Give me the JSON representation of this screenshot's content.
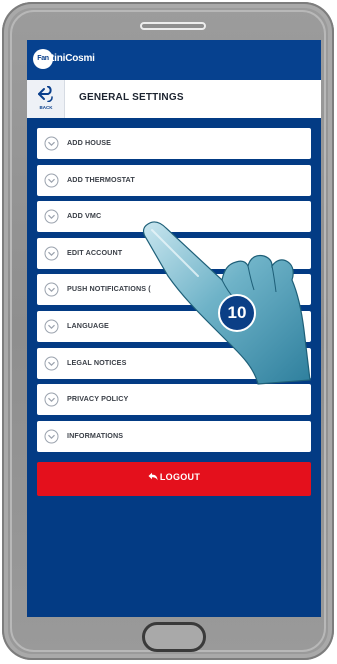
{
  "app": {
    "logo_badge": "Fan",
    "logo_text": "tiniCosmi"
  },
  "title_bar": {
    "back_label": "BACK",
    "title": "GENERAL SETTINGS"
  },
  "menu": {
    "items": [
      {
        "label": "ADD HOUSE",
        "icon": "chevron-down-circle-icon"
      },
      {
        "label": "ADD THERMOSTAT",
        "icon": "chevron-down-circle-icon"
      },
      {
        "label": "ADD VMC",
        "icon": "chevron-down-circle-icon"
      },
      {
        "label": "EDIT ACCOUNT",
        "icon": "chevron-down-circle-icon"
      },
      {
        "label": "PUSH NOTIFICATIONS (",
        "icon": "chevron-down-circle-icon"
      },
      {
        "label": "LANGUAGE",
        "icon": "chevron-down-circle-icon"
      },
      {
        "label": "LEGAL NOTICES",
        "icon": "chevron-down-circle-icon"
      },
      {
        "label": "PRIVACY POLICY",
        "icon": "chevron-down-circle-icon"
      },
      {
        "label": "INFORMATIONS",
        "icon": "chevron-down-circle-icon"
      }
    ]
  },
  "logout": {
    "label": "LOGOUT",
    "icon": "logout-arrow-icon"
  },
  "overlay": {
    "step_number": "10",
    "hand_icon": "pointing-hand-icon"
  },
  "colors": {
    "screen_bg": "#033b84",
    "header_bg": "#06418f",
    "logout_bg": "#e4101c",
    "badge_bg": "#0b3f86",
    "hand_fill": "#4a9bb8"
  }
}
